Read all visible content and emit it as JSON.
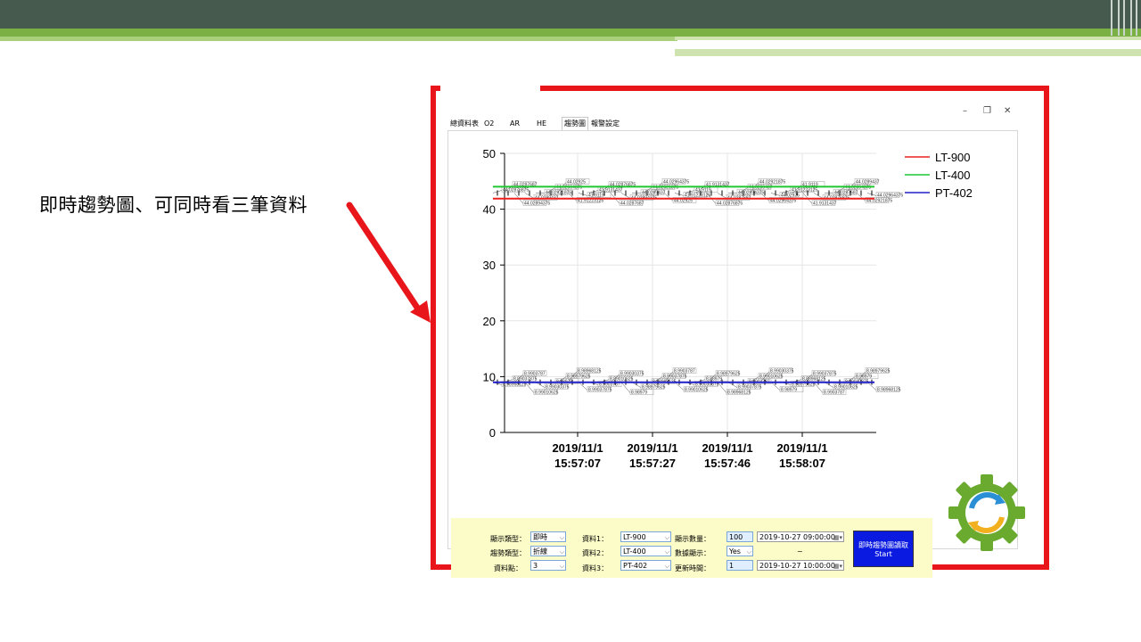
{
  "slide": {
    "caption": "即時趨勢圖、可同時看三筆資料",
    "colors": {
      "header_dark": "#465a4e",
      "header_green": "#7bb144",
      "frame_red": "#e8161b"
    }
  },
  "window": {
    "controls": {
      "minimize": "–",
      "restore": "❐",
      "close": "✕"
    }
  },
  "tabs": [
    {
      "label": "總資料表"
    },
    {
      "label": "O2"
    },
    {
      "label": "AR"
    },
    {
      "label": "HE"
    },
    {
      "label": "趨勢圖"
    },
    {
      "label": "報警設定"
    }
  ],
  "chart_data": {
    "type": "line",
    "ylim": [
      0,
      50
    ],
    "yticks": [
      0,
      10,
      20,
      30,
      40,
      50
    ],
    "x_tick_labels": [
      [
        "2019/11/1",
        "15:57:07"
      ],
      [
        "2019/11/1",
        "15:57:27"
      ],
      [
        "2019/11/1",
        "15:57:46"
      ],
      [
        "2019/11/1",
        "15:58:07"
      ]
    ],
    "legend_position": "top-right",
    "series": [
      {
        "name": "LT-900",
        "color": "#ee2020",
        "level": 41.9
      },
      {
        "name": "LT-400",
        "color": "#20c830",
        "level": 44.03
      },
      {
        "name": "PT-402",
        "color": "#2020c8",
        "level": 8.99
      }
    ],
    "data_labels_top": [
      "44.02876875",
      "44.0287687",
      "44.02894375",
      "44.0289437",
      "44.02921875",
      "44.02964375",
      "44.02925",
      "41.91223125",
      "41.9119",
      "41.9131437"
    ],
    "data_labels_bottom": [
      "8.98968125",
      "8.99037875",
      "8.9903787",
      "8.99010625",
      "8.99030375",
      "8.98979",
      "8.98979625"
    ]
  },
  "controls": {
    "display_type_label": "顯示類型：",
    "display_type_value": "即時",
    "trend_type_label": "趨勢類型：",
    "trend_type_value": "折線",
    "points_label": "資料點：",
    "points_value": "3",
    "data1_label": "資料1：",
    "data1_value": "LT-900",
    "data2_label": "資料2：",
    "data2_value": "LT-400",
    "data3_label": "資料3：",
    "data3_value": "PT-402",
    "count_label": "顯示數量：",
    "count_value": "100",
    "data_display_label": "數據顯示：",
    "data_display_value": "Yes",
    "update_label": "更新時間：",
    "update_value": "1",
    "date_start": "2019-10-27 09:00:00",
    "date_sep": "~",
    "date_end": "2019-10-27 10:00:00",
    "start_line1": "即時趨勢圖讀取",
    "start_line2": "Start"
  }
}
